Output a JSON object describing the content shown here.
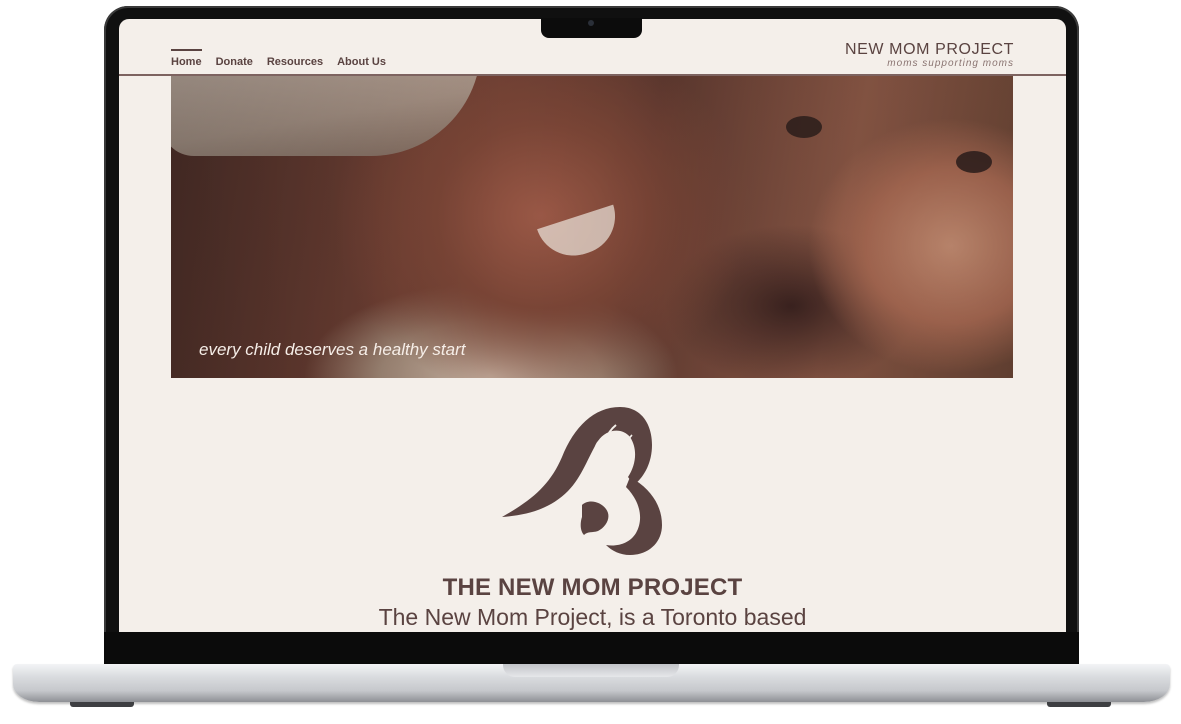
{
  "nav": {
    "items": [
      {
        "label": "Home",
        "active": true
      },
      {
        "label": "Donate",
        "active": false
      },
      {
        "label": "Resources",
        "active": false
      },
      {
        "label": "About Us",
        "active": false
      }
    ]
  },
  "brand": {
    "title": "NEW MOM PROJECT",
    "tagline": "moms supporting moms"
  },
  "hero": {
    "caption": "every child deserves a healthy start"
  },
  "main": {
    "logo_icon": "mother-and-baby-silhouette-icon",
    "headline": "THE NEW MOM PROJECT",
    "intro": "The New Mom Project, is a Toronto based"
  },
  "colors": {
    "background": "#f4efea",
    "brand_brown": "#5a4341",
    "laptop_body": "#101010"
  }
}
